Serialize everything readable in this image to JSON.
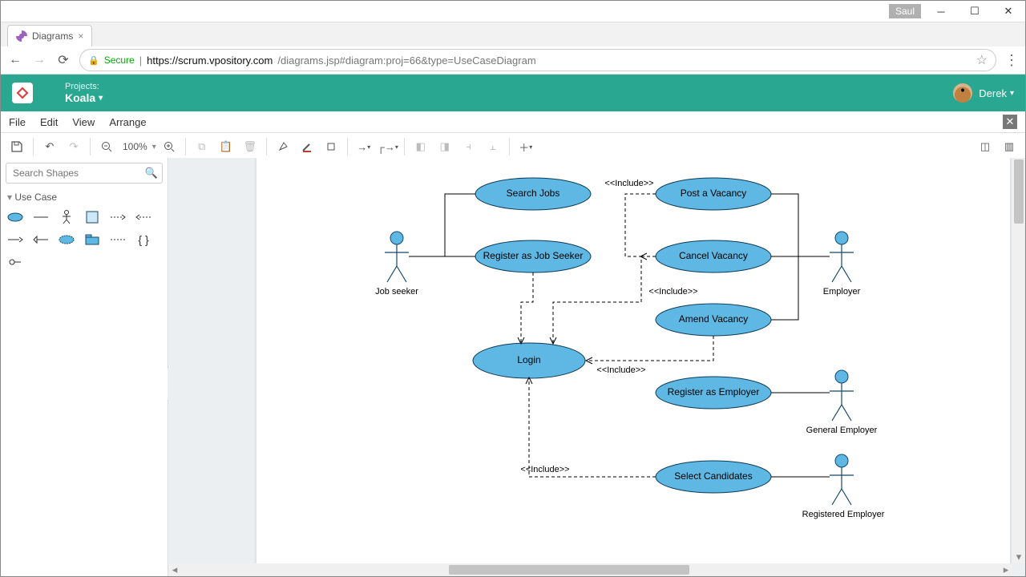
{
  "os": {
    "user_tag": "Saul"
  },
  "browser": {
    "tab_title": "Diagrams",
    "secure_label": "Secure",
    "url_host": "https://scrum.vpository.com",
    "url_path": "/diagrams.jsp#diagram:proj=66&type=UseCaseDiagram"
  },
  "app": {
    "projects_label": "Projects:",
    "project_name": "Koala",
    "user_name": "Derek"
  },
  "menubar": {
    "file": "File",
    "edit": "Edit",
    "view": "View",
    "arrange": "Arrange"
  },
  "toolbar": {
    "zoom": "100%"
  },
  "sidebar": {
    "search_placeholder": "Search Shapes",
    "palette_title": "Use Case"
  },
  "diagram": {
    "actors": {
      "job_seeker": "Job seeker",
      "employer": "Employer",
      "general_employer": "General Employer",
      "registered_employer": "Registered Employer"
    },
    "usecases": {
      "search_jobs": "Search Jobs",
      "register_job_seeker": "Register as Job Seeker",
      "login": "Login",
      "post_vacancy": "Post a Vacancy",
      "cancel_vacancy": "Cancel Vacancy",
      "amend_vacancy": "Amend Vacancy",
      "register_employer": "Register as Employer",
      "select_candidates": "Select Candidates"
    },
    "include_label": "<<Include>>",
    "relations": {
      "associations": [
        [
          "job_seeker",
          "search_jobs"
        ],
        [
          "job_seeker",
          "register_job_seeker"
        ],
        [
          "employer",
          "post_vacancy"
        ],
        [
          "employer",
          "cancel_vacancy"
        ],
        [
          "employer",
          "amend_vacancy"
        ],
        [
          "general_employer",
          "register_employer"
        ],
        [
          "registered_employer",
          "select_candidates"
        ]
      ],
      "includes": [
        [
          "register_job_seeker",
          "login"
        ],
        [
          "post_vacancy",
          "login"
        ],
        [
          "cancel_vacancy",
          "login"
        ],
        [
          "amend_vacancy",
          "login"
        ],
        [
          "select_candidates",
          "login"
        ]
      ]
    }
  }
}
